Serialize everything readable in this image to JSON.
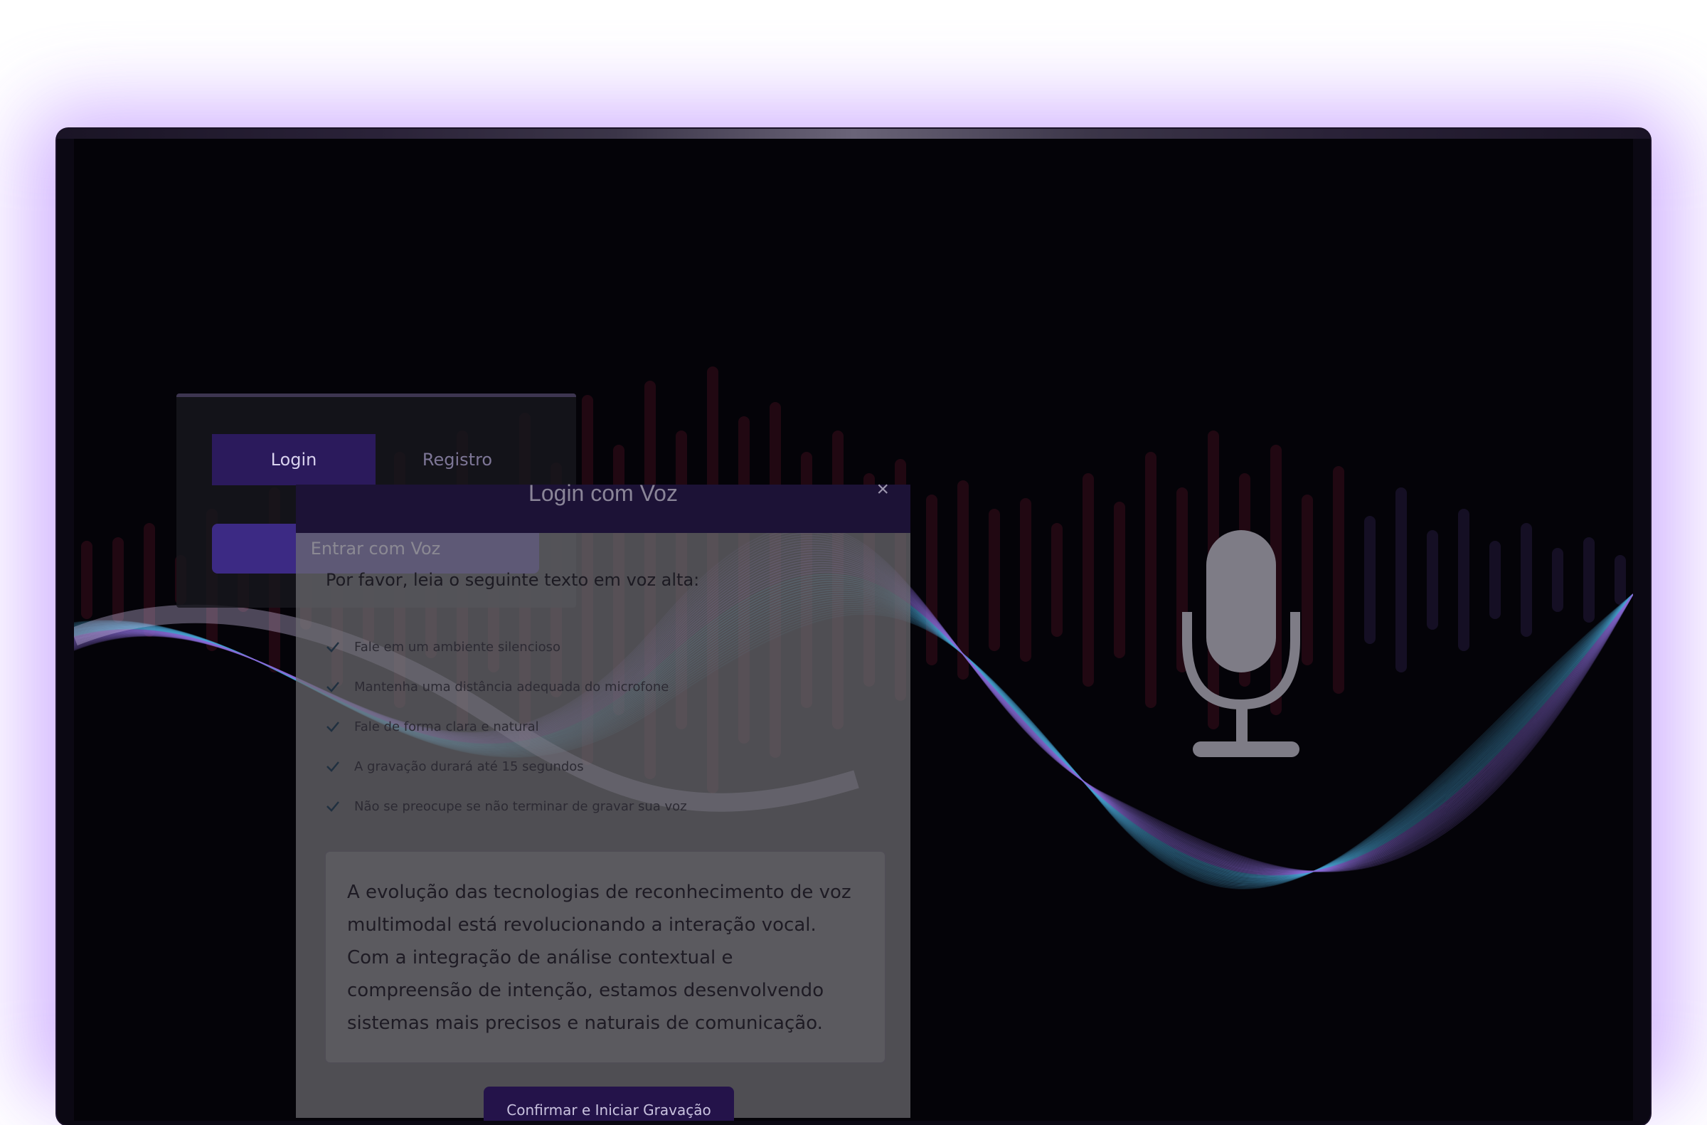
{
  "tabs": {
    "login": "Login",
    "register": "Registro"
  },
  "voice_login_button": "Entrar com Voz",
  "modal": {
    "title": "Login com Voz",
    "close": "×",
    "instruction": "Por favor, leia o seguinte texto em voz alta:",
    "tips": [
      "Fale em um ambiente silencioso",
      "Mantenha uma distância adequada do microfone",
      "Fale de forma clara e natural",
      "A gravação durará até 15 segundos",
      "Não se preocupe se não terminar de gravar sua voz"
    ],
    "passage": "A evolução das tecnologias de reconhecimento de voz multimodal está revolucionando a interação vocal. Com a integração de análise contextual e compreensão de intenção, estamos desenvolvendo sistemas mais precisos e naturais de comunicação.",
    "confirm_button": "Confirmar e Iniciar Gravação"
  },
  "icons": {
    "microphone": "microphone-icon",
    "check": "check-icon",
    "close": "close-icon"
  },
  "colors": {
    "accent": "#3c2a84",
    "modal_header": "#1c1236",
    "glow": "#c9a6ff"
  }
}
